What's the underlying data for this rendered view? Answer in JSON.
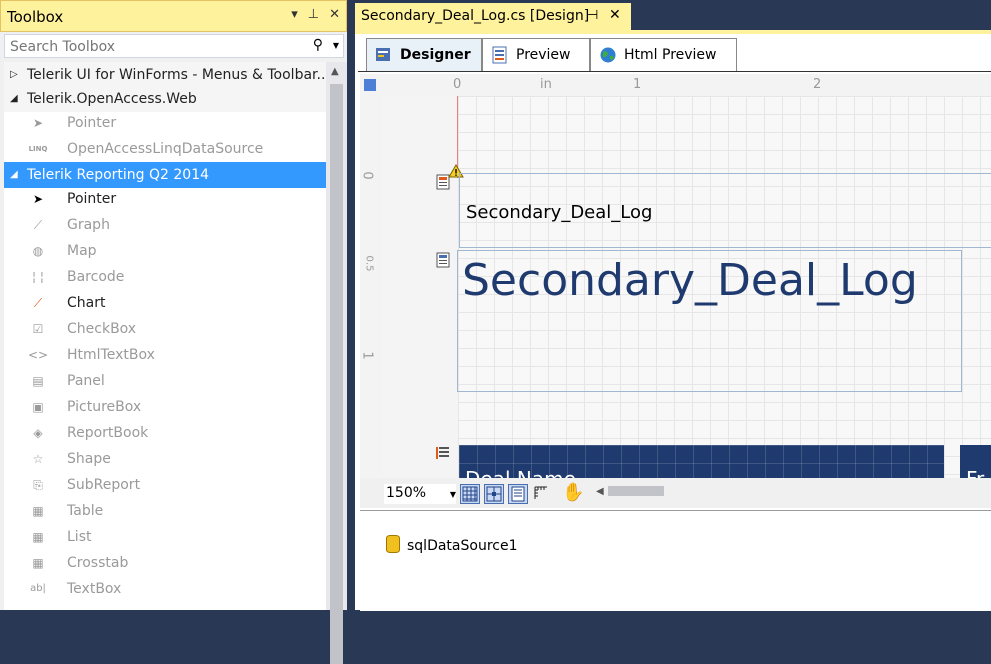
{
  "toolbox": {
    "title": "Toolbox",
    "title_buttons": [
      "▾",
      "⊥",
      "✕"
    ],
    "search": {
      "placeholder": "Search Toolbox",
      "value": ""
    },
    "groups": [
      {
        "label": "Telerik UI for WinForms - Menus & Toolbar...",
        "expanded": false
      },
      {
        "label": "Telerik.OpenAccess.Web",
        "expanded": true
      },
      {
        "label": "Telerik Reporting Q2 2014",
        "expanded": true,
        "selected": true
      }
    ],
    "openaccess_items": [
      {
        "label": "Pointer",
        "icon": "pointer-icon",
        "enabled": false
      },
      {
        "label": "OpenAccessLinqDataSource",
        "icon": "linq-datasource-icon",
        "enabled": false
      }
    ],
    "reporting_items": [
      {
        "label": "Pointer",
        "icon": "pointer-icon",
        "enabled": true
      },
      {
        "label": "Graph",
        "icon": "graph-icon",
        "enabled": false
      },
      {
        "label": "Map",
        "icon": "map-icon",
        "enabled": false
      },
      {
        "label": "Barcode",
        "icon": "barcode-icon",
        "enabled": false
      },
      {
        "label": "Chart",
        "icon": "chart-icon",
        "enabled": true
      },
      {
        "label": "CheckBox",
        "icon": "checkbox-icon",
        "enabled": false
      },
      {
        "label": "HtmlTextBox",
        "icon": "htmltextbox-icon",
        "enabled": false
      },
      {
        "label": "Panel",
        "icon": "panel-icon",
        "enabled": false
      },
      {
        "label": "PictureBox",
        "icon": "picturebox-icon",
        "enabled": false
      },
      {
        "label": "ReportBook",
        "icon": "reportbook-icon",
        "enabled": false
      },
      {
        "label": "Shape",
        "icon": "shape-icon",
        "enabled": false
      },
      {
        "label": "SubReport",
        "icon": "subreport-icon",
        "enabled": false
      },
      {
        "label": "Table",
        "icon": "table-icon",
        "enabled": false
      },
      {
        "label": "List",
        "icon": "list-icon",
        "enabled": false
      },
      {
        "label": "Crosstab",
        "icon": "crosstab-icon",
        "enabled": false
      },
      {
        "label": "TextBox",
        "icon": "textbox-icon",
        "enabled": false
      }
    ]
  },
  "document": {
    "tab_title": "Secondary_Deal_Log.cs [Design]",
    "tabs": [
      {
        "label": "Designer",
        "active": true
      },
      {
        "label": "Preview",
        "active": false
      },
      {
        "label": "Html Preview",
        "active": false
      }
    ],
    "ruler": {
      "unit": "in",
      "h_marks": [
        "0",
        "1",
        "2"
      ],
      "v_marks": [
        "0",
        "0.5",
        "1"
      ]
    },
    "report": {
      "page_header_text": "Secondary_Deal_Log",
      "title_text": "Secondary_Deal_Log",
      "column_header_1": "Deal Name",
      "column_header_2": "Fr"
    },
    "zoom": "150%",
    "components": [
      "sqlDataSource1"
    ]
  },
  "colors": {
    "accent_yellow": "#fff29d",
    "selection_blue": "#3399ff",
    "report_title_blue": "#1f3a6e",
    "frame_navy": "#293955"
  }
}
